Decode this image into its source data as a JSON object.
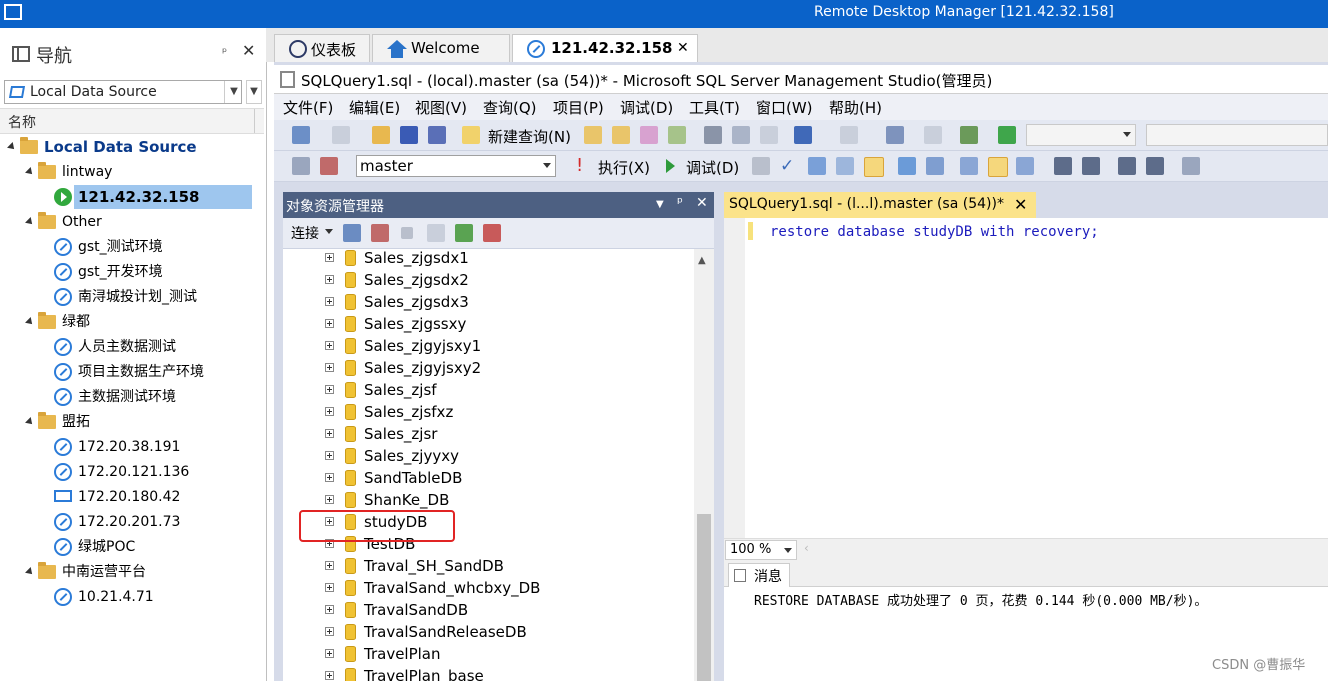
{
  "window": {
    "title": "Remote Desktop Manager [121.42.32.158]"
  },
  "nav": {
    "title": "导航",
    "pin": "ᵖ",
    "close": "✕",
    "data_source": "Local Data Source",
    "column_header": "名称",
    "tree": [
      {
        "label": "Local Data Source",
        "type": "root",
        "bold": true
      },
      {
        "label": "lintway",
        "type": "folder"
      },
      {
        "label": "121.42.32.158",
        "type": "session-active",
        "selected": true
      },
      {
        "label": "Other",
        "type": "folder"
      },
      {
        "label": "gst_测试环境",
        "type": "connection"
      },
      {
        "label": "gst_开发环境",
        "type": "connection"
      },
      {
        "label": "南浔城投计划_测试",
        "type": "connection"
      },
      {
        "label": "绿都",
        "type": "folder"
      },
      {
        "label": "人员主数据测试",
        "type": "connection"
      },
      {
        "label": "项目主数据生产环境",
        "type": "connection"
      },
      {
        "label": "主数据测试环境",
        "type": "connection"
      },
      {
        "label": "盟拓",
        "type": "folder"
      },
      {
        "label": "172.20.38.191",
        "type": "connection"
      },
      {
        "label": "172.20.121.136",
        "type": "connection"
      },
      {
        "label": "172.20.180.42",
        "type": "monitor"
      },
      {
        "label": "172.20.201.73",
        "type": "connection"
      },
      {
        "label": "绿城POC",
        "type": "connection"
      },
      {
        "label": "中南运营平台",
        "type": "folder"
      },
      {
        "label": "10.21.4.71",
        "type": "connection"
      }
    ]
  },
  "tabs": [
    {
      "label": "仪表板",
      "icon": "dashboard-icon"
    },
    {
      "label": "Welcome",
      "icon": "home-icon"
    },
    {
      "label": "121.42.32.158",
      "icon": "rdp-icon",
      "active": true,
      "close": "✕"
    }
  ],
  "ssms": {
    "title": "SQLQuery1.sql - (local).master (sa (54))* - Microsoft SQL Server Management Studio(管理员)",
    "menu": [
      "文件(F)",
      "编辑(E)",
      "视图(V)",
      "查询(Q)",
      "项目(P)",
      "调试(D)",
      "工具(T)",
      "窗口(W)",
      "帮助(H)"
    ],
    "toolbar1": {
      "new_query": "新建查询(N)"
    },
    "toolbar2": {
      "database": "master",
      "execute": "执行(X)",
      "debug": "调试(D)"
    },
    "object_explorer": {
      "title": "对象资源管理器",
      "connect": "连接",
      "close": "✕",
      "databases": [
        "Sales_zjgsdx1",
        "Sales_zjgsdx2",
        "Sales_zjgsdx3",
        "Sales_zjgssxy",
        "Sales_zjgyjsxy1",
        "Sales_zjgyjsxy2",
        "Sales_zjsf",
        "Sales_zjsfxz",
        "Sales_zjsr",
        "Sales_zjyyxy",
        "SandTableDB",
        "ShanKe_DB",
        "studyDB",
        "TestDB",
        "Traval_SH_SandDB",
        "TravalSand_whcbxy_DB",
        "TravalSandDB",
        "TravalSandReleaseDB",
        "TravelPlan",
        "TravelPlan_base"
      ]
    },
    "query_tab": {
      "label": "SQLQuery1.sql - (l...l).master (sa (54))*",
      "close": "✕"
    },
    "editor_code": "restore database studyDB with recovery;",
    "zoom": "100 %",
    "messages_tab": "消息",
    "message": "RESTORE DATABASE 成功处理了 0 页，花费 0.144 秒(0.000 MB/秒)。"
  },
  "watermark": "CSDN @曹振华",
  "colors": {
    "titlebar": "#0a62c9",
    "selection": "#9ec6ee",
    "oe_header": "#4d6082",
    "highlight_box": "#e12424"
  }
}
